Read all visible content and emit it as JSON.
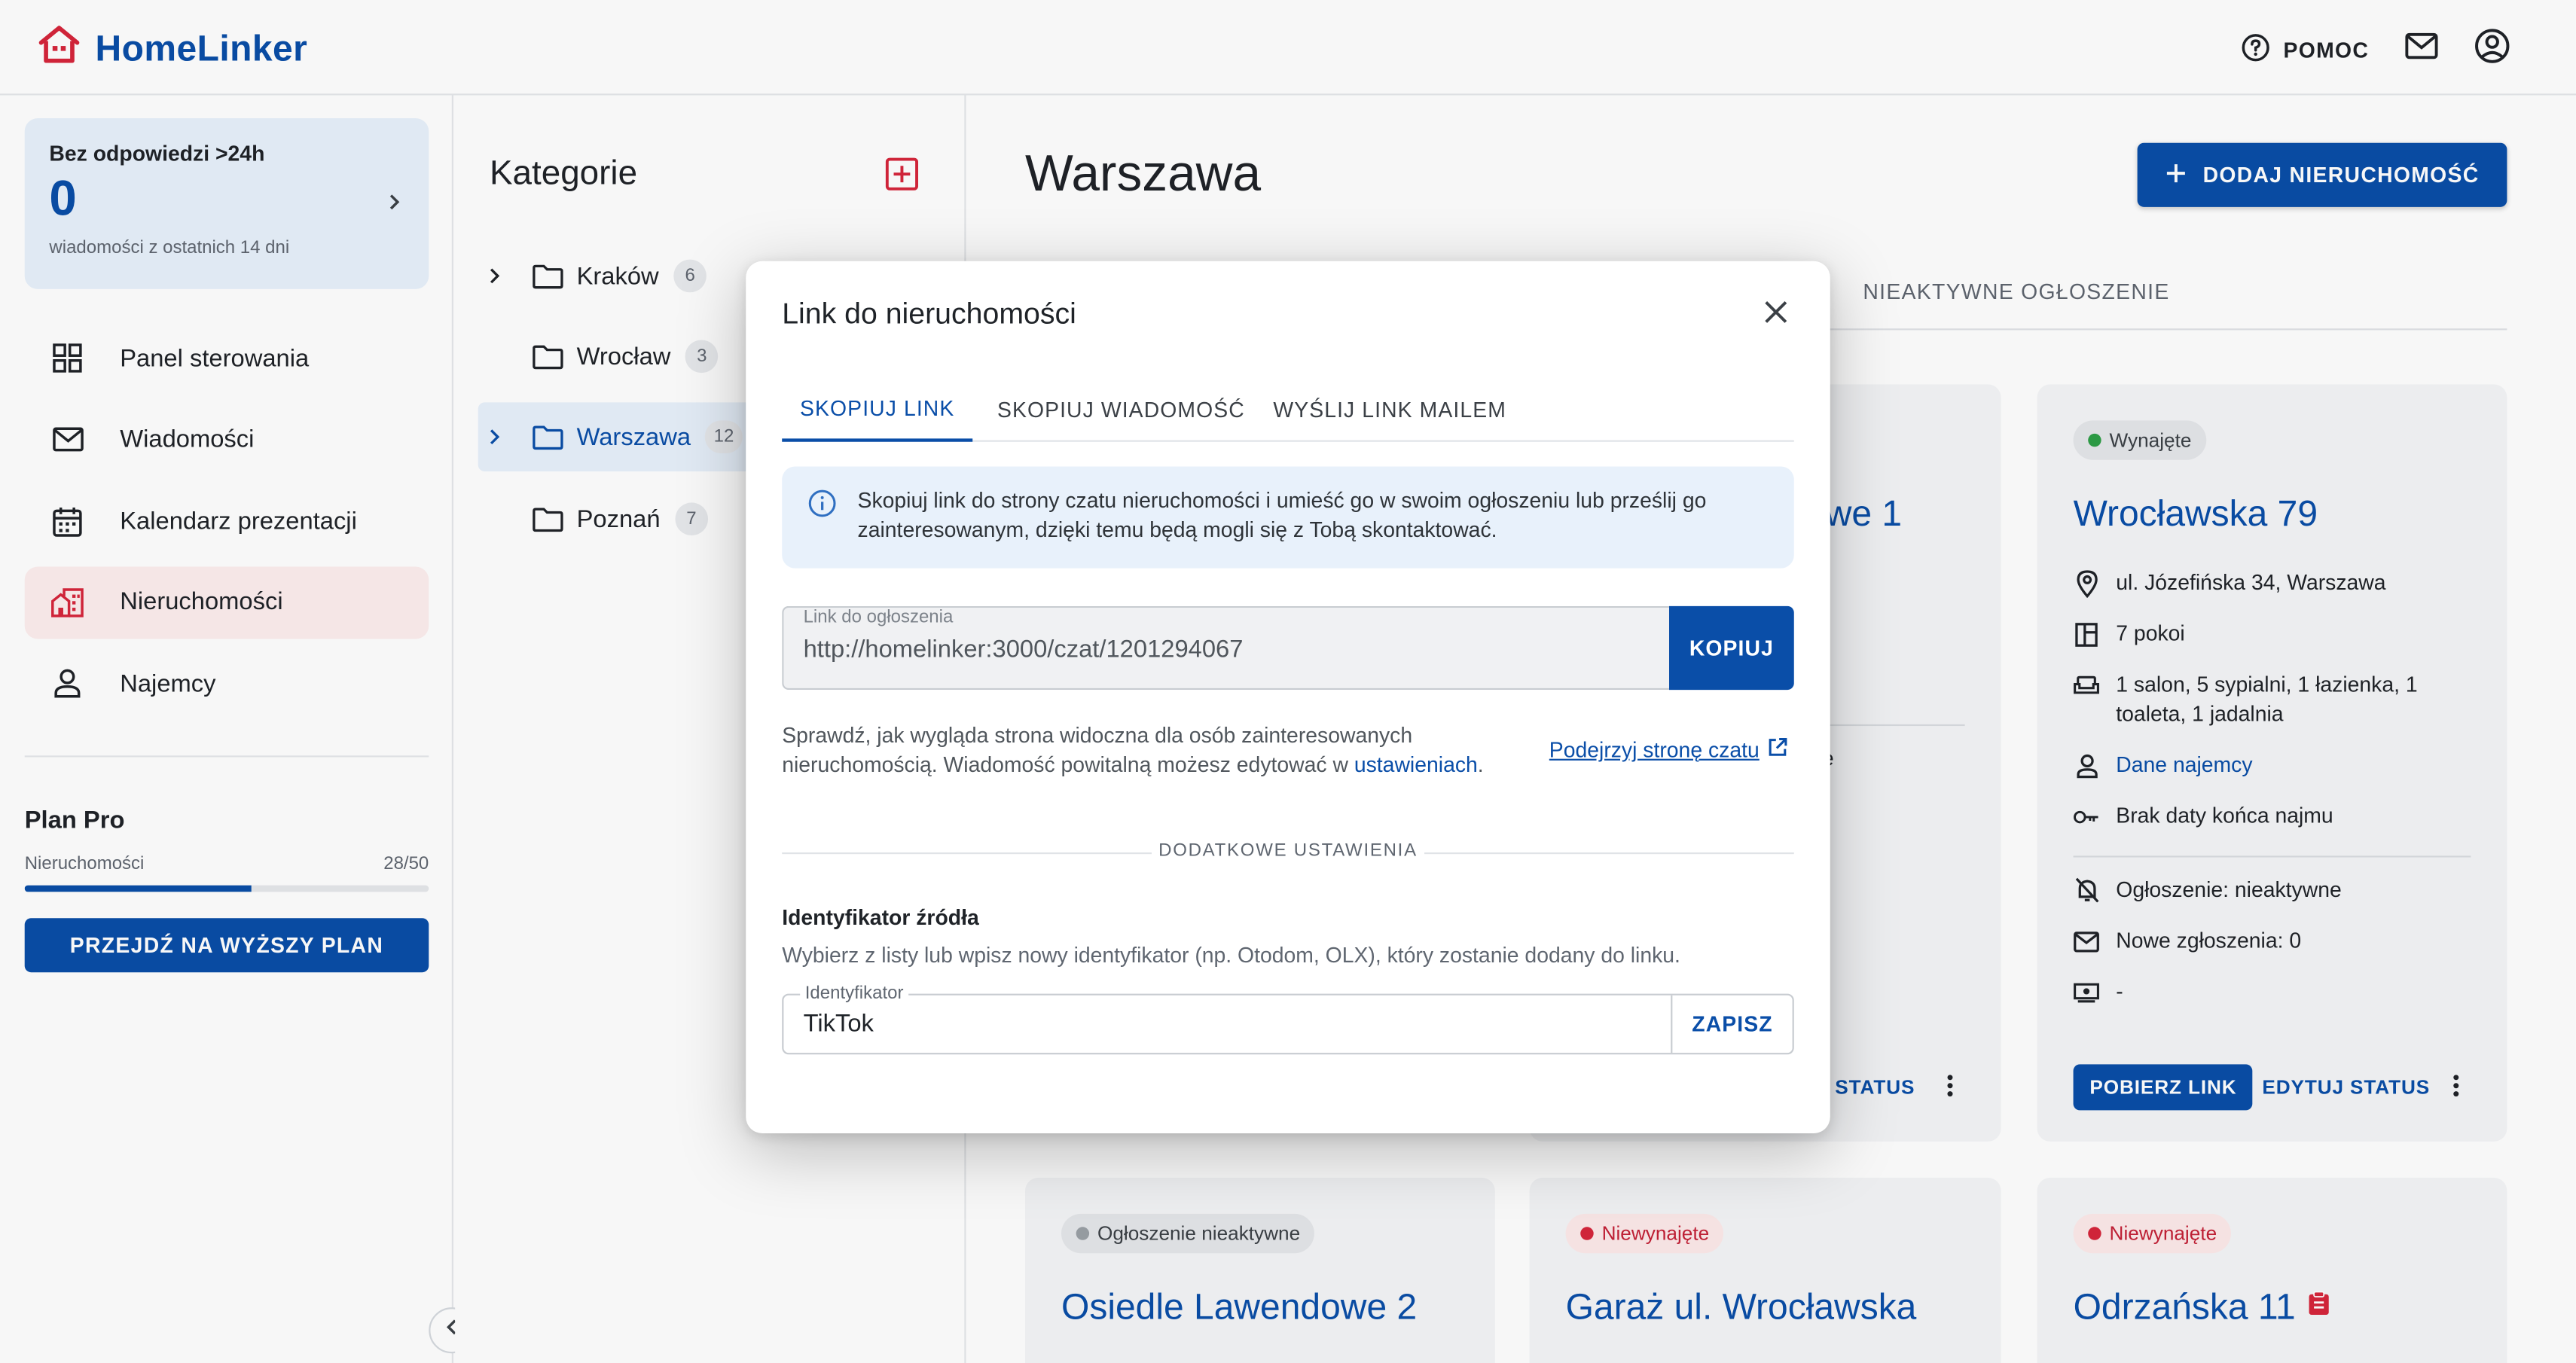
{
  "app": {
    "name": "HomeLinker"
  },
  "header": {
    "help_label": "POMOC"
  },
  "colors": {
    "primary": "#0a4ea8",
    "accent_red": "#d6263b",
    "rented_green": "#2e9e47",
    "inactive_gray": "#9aa0a6"
  },
  "sidebar": {
    "unanswered": {
      "title": "Bez odpowiedzi >24h",
      "count": "0",
      "subtitle": "wiadomości z ostatnich 14 dni"
    },
    "items": [
      {
        "label": "Panel sterowania",
        "icon": "dashboard-icon",
        "active": false
      },
      {
        "label": "Wiadomości",
        "icon": "mail-icon",
        "active": false
      },
      {
        "label": "Kalendarz prezentacji",
        "icon": "calendar-icon",
        "active": false
      },
      {
        "label": "Nieruchomości",
        "icon": "buildings-icon",
        "active": true
      },
      {
        "label": "Najemcy",
        "icon": "person-icon",
        "active": false
      }
    ],
    "plan": {
      "title": "Plan Pro",
      "label": "Nieruchomości",
      "usage": "28/50",
      "progress": 0.56,
      "upgrade_label": "PRZEJDŹ NA WYŻSZY PLAN"
    }
  },
  "categories": {
    "title": "Kategorie",
    "items": [
      {
        "name": "Kraków",
        "count": "6",
        "expandable": true,
        "active": false
      },
      {
        "name": "Wrocław",
        "count": "3",
        "expandable": false,
        "active": false
      },
      {
        "name": "Warszawa",
        "count": "12",
        "expandable": true,
        "active": true
      },
      {
        "name": "Poznań",
        "count": "7",
        "expandable": false,
        "active": false
      }
    ]
  },
  "main": {
    "title": "Warszawa",
    "add_button": "DODAJ NIERUCHOMOŚĆ",
    "tab_inactive": "NIEAKTYWNE OGŁOSZENIE",
    "partial_card": {
      "title_tail": "owe 1",
      "text_tail": "e",
      "status_btn_tail": "STATUS"
    },
    "card": {
      "status": "Wynajęte",
      "title": "Wrocławska 79",
      "address": "ul. Józefińska 34, Warszawa",
      "rooms": "7 pokoi",
      "layout": "1 salon, 5 sypialni, 1 łazienka, 1 toaleta, 1 jadalnia",
      "tenant_link": "Dane najemcy",
      "lease_end": "Brak daty końca najmu",
      "listing": "Ogłoszenie: nieaktywne",
      "new_requests": "Nowe zgłoszenia: 0",
      "payment": "-",
      "get_link": "POBIERZ LINK",
      "edit_status": "EDYTUJ STATUS"
    },
    "bottom_cards": [
      {
        "status": "Ogłoszenie nieaktywne",
        "title": "Osiedle Lawendowe 2"
      },
      {
        "status": "Niewynajęte",
        "title": "Garaż ul. Wrocławska"
      },
      {
        "status": "Niewynajęte",
        "title": "Odrzańska 11"
      }
    ]
  },
  "modal": {
    "title": "Link do nieruchomości",
    "tabs": [
      "SKOPIUJ LINK",
      "SKOPIUJ WIADOMOŚĆ",
      "WYŚLIJ LINK MAILEM"
    ],
    "info": "Skopiuj link do strony czatu nieruchomości i umieść go w swoim ogłoszeniu lub prześlij go zainteresowanym, dzięki temu będą mogli się z Tobą skontaktować.",
    "link_label": "Link do ogłoszenia",
    "link_value": "http://homelinker:3000/czat/1201294067",
    "copy_button": "KOPIUJ",
    "hint_text": "Sprawdź, jak wygląda strona widoczna dla osób zainteresowanych nieruchomością. Wiadomość powitalną możesz edytować w",
    "hint_link": "ustawieniach",
    "preview_link": "Podejrzyj stronę czatu",
    "divider": "DODATKOWE USTAWIENIA",
    "source_title": "Identyfikator źródła",
    "source_desc": "Wybierz z listy lub wpisz nowy identyfikator (np. Otodom, OLX), który zostanie dodany do linku.",
    "id_label": "Identyfikator",
    "id_value": "TikTok",
    "save_button": "ZAPISZ"
  }
}
